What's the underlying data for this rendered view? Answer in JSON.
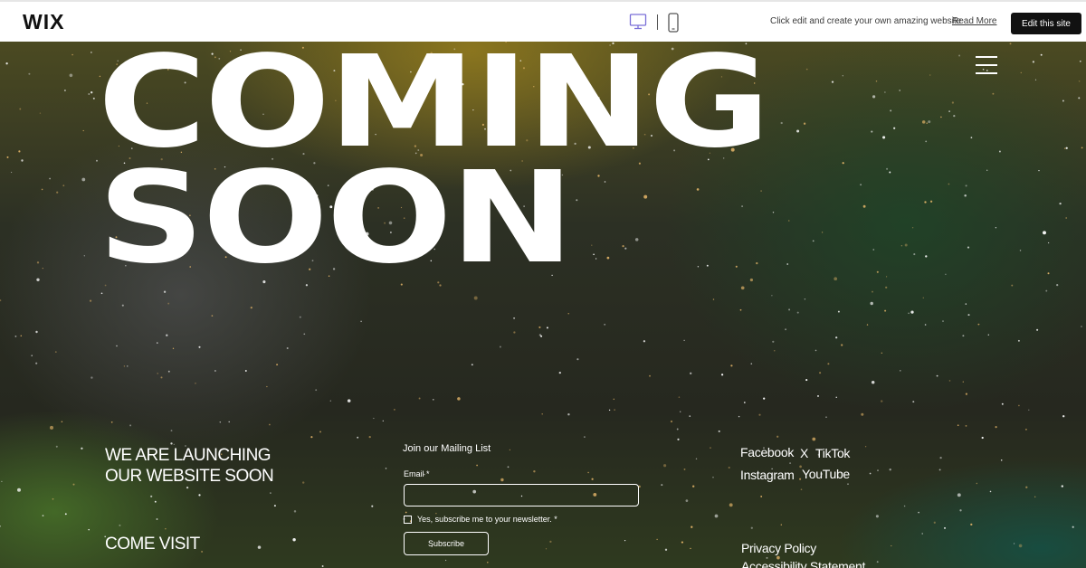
{
  "topbar": {
    "logo": "WIX",
    "promo_text": "Click edit and create your own amazing website",
    "read_more": "Read More",
    "edit_button": "Edit this site",
    "colors": {
      "device_active": "#7a6fd8",
      "button_bg": "#111111"
    }
  },
  "hero": {
    "headline_line1": "COMING",
    "headline_line2": "SOON",
    "launch_text": "WE ARE LAUNCHING OUR WEBSITE SOON",
    "come_visit": "COME VISIT"
  },
  "mailing": {
    "title": "Join our Mailing List",
    "email_label": "Email *",
    "email_value": "",
    "checkbox_label": "Yes, subscribe me to your newsletter. *",
    "subscribe_button": "Subscribe"
  },
  "social": {
    "facebook": "Facebook",
    "x": "X",
    "tiktok": "TikTok",
    "instagram": "Instagram",
    "youtube": "YouTube"
  },
  "legal": {
    "privacy": "Privacy Policy",
    "accessibility": "Accessibility Statement"
  }
}
